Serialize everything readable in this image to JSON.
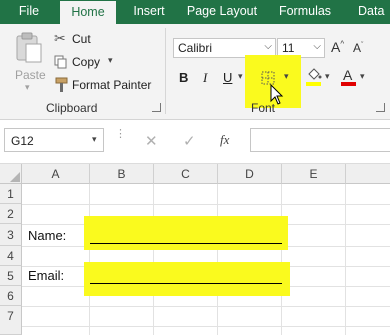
{
  "tabs": [
    "File",
    "Home",
    "Insert",
    "Page Layout",
    "Formulas",
    "Data"
  ],
  "clipboard": {
    "paste_label": "Paste",
    "cut_label": "Cut",
    "copy_label": "Copy",
    "format_painter_label": "Format Painter",
    "group_label": "Clipboard"
  },
  "font": {
    "font_name": "Calibri",
    "font_size": "11",
    "bold": "B",
    "italic": "I",
    "underline": "U",
    "group_label": "Font",
    "highlight_color": "#ffff00",
    "font_color": "#e00000"
  },
  "formula_bar": {
    "name_box": "G12",
    "fx_label": "fx",
    "cancel_icon": "close-icon",
    "enter_icon": "check-icon"
  },
  "sheet": {
    "columns": [
      "A",
      "B",
      "C",
      "D",
      "E"
    ],
    "rows": [
      "1",
      "2",
      "3",
      "4",
      "5",
      "6",
      "7"
    ],
    "cells": {
      "A3": "Name:",
      "A5": "Email:"
    },
    "highlight_color": "#fafa1e"
  },
  "accent": "#217346"
}
